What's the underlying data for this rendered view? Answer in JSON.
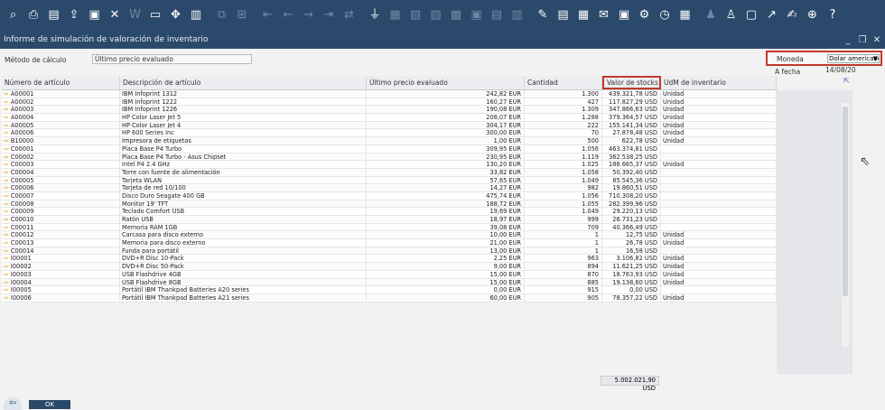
{
  "toolbar": {
    "icons": [
      {
        "name": "search-icon",
        "glyph": "⌕",
        "dim": false
      },
      {
        "name": "print-icon",
        "glyph": "⎙",
        "dim": false
      },
      {
        "name": "print-preview-icon",
        "glyph": "▤",
        "dim": false
      },
      {
        "name": "export-icon",
        "glyph": "⇪",
        "dim": false
      },
      {
        "name": "email-icon",
        "glyph": "▣",
        "dim": false
      },
      {
        "name": "excel-icon",
        "glyph": "✕",
        "dim": false
      },
      {
        "name": "word-icon",
        "glyph": "W",
        "dim": true
      },
      {
        "name": "pdf-icon",
        "glyph": "▭",
        "dim": false
      },
      {
        "name": "move-icon",
        "glyph": "✥",
        "dim": false
      },
      {
        "name": "document-icon",
        "glyph": "▥",
        "dim": false
      },
      {
        "name": "columns-icon",
        "glyph": "⧉",
        "dim": true
      },
      {
        "name": "grid-icon",
        "glyph": "⊞",
        "dim": true
      },
      {
        "name": "first-record-icon",
        "glyph": "⇤",
        "dim": true
      },
      {
        "name": "previous-record-icon",
        "glyph": "←",
        "dim": true
      },
      {
        "name": "next-record-icon",
        "glyph": "→",
        "dim": true
      },
      {
        "name": "last-record-icon",
        "glyph": "⇥",
        "dim": true
      },
      {
        "name": "refresh-icon",
        "glyph": "⇄",
        "dim": true
      },
      {
        "name": "filter-icon",
        "glyph": "⏚",
        "dim": false
      },
      {
        "name": "sort-icon",
        "glyph": "▦",
        "dim": true
      },
      {
        "name": "base-document-icon",
        "glyph": "▧",
        "dim": true
      },
      {
        "name": "target-document-icon",
        "glyph": "▨",
        "dim": true
      },
      {
        "name": "gross-profit-icon",
        "glyph": "▩",
        "dim": true
      },
      {
        "name": "journal-icon",
        "glyph": "▣",
        "dim": true
      },
      {
        "name": "layout-icon",
        "glyph": "▤",
        "dim": true
      },
      {
        "name": "volume-icon",
        "glyph": "▥",
        "dim": true
      },
      {
        "name": "edit-icon",
        "glyph": "✎",
        "dim": false
      },
      {
        "name": "form-settings-icon",
        "glyph": "▤",
        "dim": false
      },
      {
        "name": "user-defined-icon",
        "glyph": "▦",
        "dim": false
      },
      {
        "name": "message-icon",
        "glyph": "✉",
        "dim": false
      },
      {
        "name": "alerts-icon",
        "glyph": "▣",
        "dim": false
      },
      {
        "name": "settings-icon",
        "glyph": "⚙",
        "dim": false
      },
      {
        "name": "history-icon",
        "glyph": "◷",
        "dim": false
      },
      {
        "name": "calculator-icon",
        "glyph": "▦",
        "dim": false
      },
      {
        "name": "users-icon",
        "glyph": "♟",
        "dim": true
      },
      {
        "name": "user-icon",
        "glyph": "♙",
        "dim": false
      },
      {
        "name": "query-icon",
        "glyph": "▢",
        "dim": false
      },
      {
        "name": "chart-icon",
        "glyph": "↗",
        "dim": false
      },
      {
        "name": "signature-icon",
        "glyph": "✍",
        "dim": false
      },
      {
        "name": "web-icon",
        "glyph": "⊕",
        "dim": false
      },
      {
        "name": "help-icon",
        "glyph": "?",
        "dim": false
      }
    ]
  },
  "window": {
    "title": "Informe de simulación de valoración de inventario"
  },
  "filters": {
    "method_label": "Método de cálculo",
    "method_value": "Último precio evaluado",
    "currency_label": "Moneda",
    "currency_value": "Dolar americano",
    "date_label": "A fecha",
    "date_value": "14/08/20"
  },
  "table": {
    "headers": [
      "Número de artículo",
      "Descripción de artículo",
      "Último precio evaluado",
      "Cantidad",
      "Valor de stocks",
      "UdM de inventario"
    ],
    "rows": [
      [
        "A00001",
        "IBM Infoprint 1312",
        "242,82 EUR",
        "1.300",
        "439.321,78 USD",
        "Unidad"
      ],
      [
        "A00002",
        "IBM Infoprint 1222",
        "160,27 EUR",
        "427",
        "117.827,29 USD",
        "Unidad"
      ],
      [
        "A00003",
        "IBM Infoprint 1226",
        "190,08 EUR",
        "1.309",
        "347.866,63 USD",
        "Unidad"
      ],
      [
        "A00004",
        "HP Color Laser Jet 5",
        "208,07 EUR",
        "1.288",
        "379.364,57 USD",
        "Unidad"
      ],
      [
        "A00005",
        "HP Color Laser Jet 4",
        "304,17 EUR",
        "222",
        "155.141,34 USD",
        "Unidad"
      ],
      [
        "A00006",
        "HP 600 Series Inc",
        "300,00 EUR",
        "70",
        "27.878,48 USD",
        "Unidad"
      ],
      [
        "B10000",
        "Impresora de etiquetas",
        "1,00 EUR",
        "500",
        "622,78 USD",
        "Unidad"
      ],
      [
        "C00001",
        "Placa Base P4 Turbo",
        "309,95 EUR",
        "1.056",
        "463.374,81 USD",
        ""
      ],
      [
        "C00002",
        "Placa Base P4 Turbo - Asus Chipset",
        "230,95 EUR",
        "1.119",
        "362.538,25 USD",
        ""
      ],
      [
        "C00003",
        "Intel P4 2.4 GHz",
        "130,20 EUR",
        "1.025",
        "188.665,37 USD",
        "Unidad"
      ],
      [
        "C00004",
        "Torre con fuente de alimentación",
        "33,82 EUR",
        "1.058",
        "50.392,40 USD",
        ""
      ],
      [
        "C00005",
        "Tarjeta WLAN",
        "57,65 EUR",
        "1.049",
        "85.545,36 USD",
        ""
      ],
      [
        "C00006",
        "Tarjeta de red 10/100",
        "14,27 EUR",
        "982",
        "19.860,51 USD",
        ""
      ],
      [
        "C00007",
        "Disco Duro Seagate 400 GB",
        "475,74 EUR",
        "1.056",
        "710.308,20 USD",
        ""
      ],
      [
        "C00008",
        "Monitor 19' TFT",
        "188,72 EUR",
        "1.055",
        "282.399,96 USD",
        ""
      ],
      [
        "C00009",
        "Teclado Comfort USB",
        "19,69 EUR",
        "1.049",
        "29.220,13 USD",
        ""
      ],
      [
        "C00010",
        "Ratón USB",
        "18,97 EUR",
        "999",
        "26.731,23 USD",
        ""
      ],
      [
        "C00011",
        "Memoria RAM 1GB",
        "39,08 EUR",
        "709",
        "40.366,49 USD",
        ""
      ],
      [
        "C00012",
        "Carcasa para disco externo",
        "10,00 EUR",
        "1",
        "12,75 USD",
        "Unidad"
      ],
      [
        "C00013",
        "Memoria para disco externo",
        "21,00 EUR",
        "1",
        "26,78 USD",
        "Unidad"
      ],
      [
        "C00014",
        "Funda para portátil",
        "13,00 EUR",
        "1",
        "16,58 USD",
        ""
      ],
      [
        "I00001",
        "DVD+R Disc 10-Pack",
        "2,25 EUR",
        "963",
        "3.106,82 USD",
        "Unidad"
      ],
      [
        "I00002",
        "DVD+R Disc 50-Pack",
        "9,00 EUR",
        "894",
        "11.621,25 USD",
        "Unidad"
      ],
      [
        "I00003",
        "USB Flashdrive 4GB",
        "15,00 EUR",
        "870",
        "18.763,93 USD",
        "Unidad"
      ],
      [
        "I00004",
        "USB Flashdrive 8GB",
        "15,00 EUR",
        "885",
        "19.138,60 USD",
        "Unidad"
      ],
      [
        "I00005",
        "Portátil IBM Thankpad Batteries A20 series",
        "0,00 EUR",
        "915",
        "0,00 USD",
        ""
      ],
      [
        "I00006",
        "Portátil IBM Thankpad Batteries A21 series",
        "60,00 EUR",
        "905",
        "78.357,22 USD",
        "Unidad"
      ]
    ],
    "total": "5.002.021,90 USD"
  },
  "buttons": {
    "ok_label": "OK"
  },
  "colors": {
    "toolbar_bg": "#2b4a6b",
    "highlight_border": "#c0392b",
    "link_arrow": "#e6a000"
  }
}
